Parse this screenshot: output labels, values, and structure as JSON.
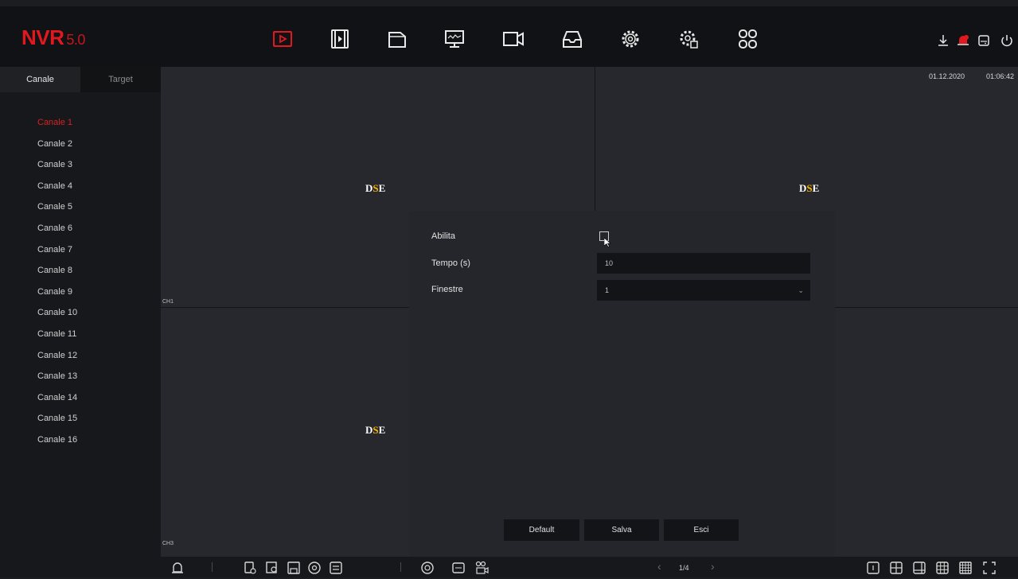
{
  "app": {
    "name": "NVR",
    "version": "5.0"
  },
  "topbar": {
    "nav_icons": [
      "playback-icon",
      "video-clip-icon",
      "file-manager-icon",
      "monitor-icon",
      "camera-icon",
      "backup-icon",
      "settings-icon",
      "advanced-settings-icon",
      "apps-icon"
    ],
    "right_icons": [
      "download-icon",
      "alarm-notification-icon",
      "disk-icon",
      "power-icon"
    ]
  },
  "sidebar": {
    "tabs": [
      "Canale",
      "Target"
    ],
    "channels": [
      "Canale 1",
      "Canale 2",
      "Canale 3",
      "Canale 4",
      "Canale 5",
      "Canale 6",
      "Canale 7",
      "Canale 8",
      "Canale 9",
      "Canale 10",
      "Canale 11",
      "Canale 12",
      "Canale 13",
      "Canale 14",
      "Canale 15",
      "Canale 16"
    ]
  },
  "video": {
    "watermark": {
      "part1": "D",
      "part2": "S",
      "part3": "E"
    },
    "ch1_label": "CH1",
    "ch3_label": "CH3",
    "date": "01.12.2020",
    "time": "01:06:42"
  },
  "dialog": {
    "enable_label": "Abilita",
    "enable_checked": false,
    "time_label": "Tempo (s)",
    "time_value": "10",
    "windows_label": "Finestre",
    "windows_value": "1",
    "buttons": {
      "default": "Default",
      "save": "Salva",
      "exit": "Esci"
    }
  },
  "bottombar": {
    "page": "1/4"
  },
  "colors": {
    "accent": "#e0191f",
    "watermark_highlight": "#f7b500"
  }
}
